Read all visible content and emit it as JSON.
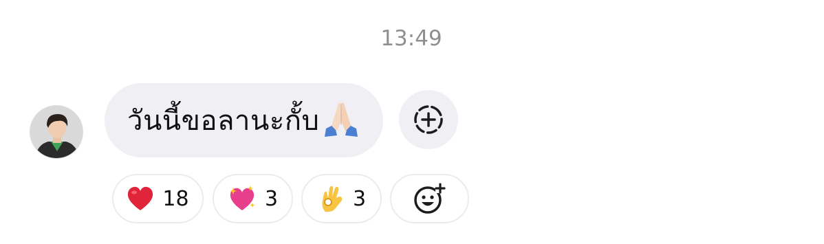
{
  "timestamp": "13:49",
  "message": {
    "text": "วันนี้ขอลานะกั้บ",
    "emoji_icon": "folded-hands-icon"
  },
  "avatar": {
    "icon": "user-avatar"
  },
  "add_reaction": {
    "icon": "dashed-circle-plus-icon"
  },
  "reactions": [
    {
      "icon": "red-heart-icon",
      "count": "18"
    },
    {
      "icon": "sparkling-heart-icon",
      "count": "3"
    },
    {
      "icon": "ok-hand-icon",
      "count": "3"
    },
    {
      "icon": "add-emoji-icon",
      "count": ""
    }
  ],
  "colors": {
    "bubble_bg": "#efeff4",
    "timestamp": "#8e8e93",
    "heart": "#e0243a",
    "sparkling_heart": "#e83f8c"
  }
}
